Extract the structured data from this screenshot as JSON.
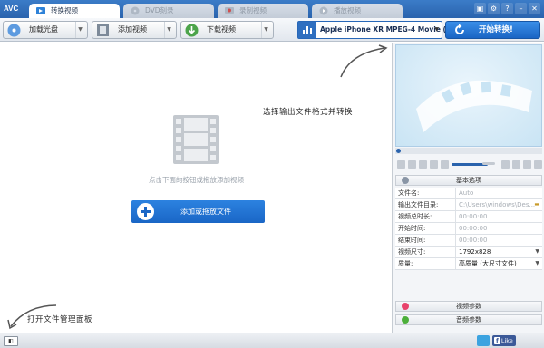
{
  "app": {
    "logo": "AVC"
  },
  "tabs": [
    {
      "label": "转换视频",
      "active": true
    },
    {
      "label": "DVD刻录",
      "active": false
    },
    {
      "label": "录制视频",
      "active": false
    },
    {
      "label": "播放视频",
      "active": false
    }
  ],
  "window_controls": [
    "▣",
    "⚙",
    "?",
    "–",
    "✕"
  ],
  "toolbar": {
    "load_disc": "加载光盘",
    "add_video": "添加视频",
    "download_video": "下载视频",
    "format": "Apple iPhone XR MPEG-4 Movie (*.m...",
    "convert": "开始转换!"
  },
  "main": {
    "hint_select_format": "选择输出文件格式并转换",
    "hint_drop": "点击下面的按钮或拖放添加视频",
    "add_button": "添加或拖放文件",
    "hint_open_panel": "打开文件管理面板"
  },
  "right_panel": {
    "basic_options": "基本选项",
    "properties": [
      {
        "label": "文件名:",
        "value": "Auto",
        "dark": false,
        "dropdown": false
      },
      {
        "label": "输出文件目录:",
        "value": "C:\\Users\\windows\\Des...",
        "dark": false,
        "dropdown": false
      },
      {
        "label": "视频总时长:",
        "value": "00:00:00",
        "dark": false,
        "dropdown": false
      },
      {
        "label": "开始时间:",
        "value": "00:00:00",
        "dark": false,
        "dropdown": false
      },
      {
        "label": "结束时间:",
        "value": "00:00:00",
        "dark": false,
        "dropdown": false
      },
      {
        "label": "视频尺寸:",
        "value": "1792x828",
        "dark": true,
        "dropdown": true
      },
      {
        "label": "质量:",
        "value": "高质量 (大尺寸文件)",
        "dark": true,
        "dropdown": true
      }
    ],
    "video_params": "视频参数",
    "audio_params": "音频参数"
  },
  "statusbar": {
    "facebook_like": "Like"
  },
  "colors": {
    "accent": "#2a63ad",
    "convert": "#1a65c4",
    "video_param_icon": "#e8426b",
    "audio_param_icon": "#4caf3a"
  }
}
